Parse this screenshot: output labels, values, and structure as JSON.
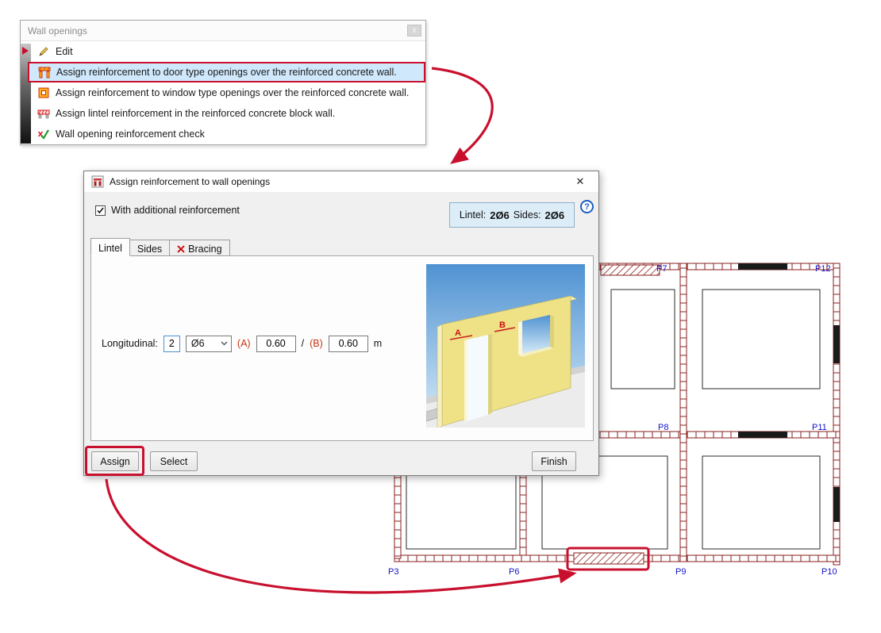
{
  "menu": {
    "title": "Wall openings",
    "close_glyph": "x",
    "items": [
      {
        "label": "Edit"
      },
      {
        "label": "Assign reinforcement to door type openings over the reinforced concrete wall."
      },
      {
        "label": "Assign reinforcement to window type openings over the reinforced concrete wall."
      },
      {
        "label": "Assign lintel reinforcement in the reinforced concrete block wall."
      },
      {
        "label": "Wall opening reinforcement check"
      }
    ]
  },
  "dialog": {
    "title": "Assign reinforcement to wall openings",
    "close_glyph": "✕",
    "help_glyph": "?",
    "additional_reinforcement_label": "With additional reinforcement",
    "summary": {
      "lintel_label": "Lintel:",
      "lintel_value": "2Ø6",
      "sides_label": "Sides:",
      "sides_value": "2Ø6"
    },
    "tabs": {
      "lintel": "Lintel",
      "sides": "Sides",
      "bracing": "Bracing"
    },
    "form": {
      "longitudinal_label": "Longitudinal:",
      "bar_count": "2",
      "bar_diameter": "Ø6",
      "a_label": "(A)",
      "a_value": "0.60",
      "separator": "/",
      "b_label": "(B)",
      "b_value": "0.60",
      "unit": "m",
      "illustration": {
        "label_a": "A",
        "label_b": "B"
      }
    },
    "buttons": {
      "assign": "Assign",
      "select": "Select",
      "finish": "Finish"
    }
  },
  "plan": {
    "labels": {
      "p3": "P3",
      "p6": "P6",
      "p7": "P7",
      "p8": "P8",
      "p9": "P9",
      "p10": "P10",
      "p11": "P11",
      "p12": "P12"
    }
  },
  "colors": {
    "annotation_red": "#c8102e",
    "wall_red": "#8a1f1f",
    "plan_label_blue": "#1414c8",
    "menu_highlight_blue": "#cfe8fb",
    "summary_bg": "#dcedf8"
  }
}
